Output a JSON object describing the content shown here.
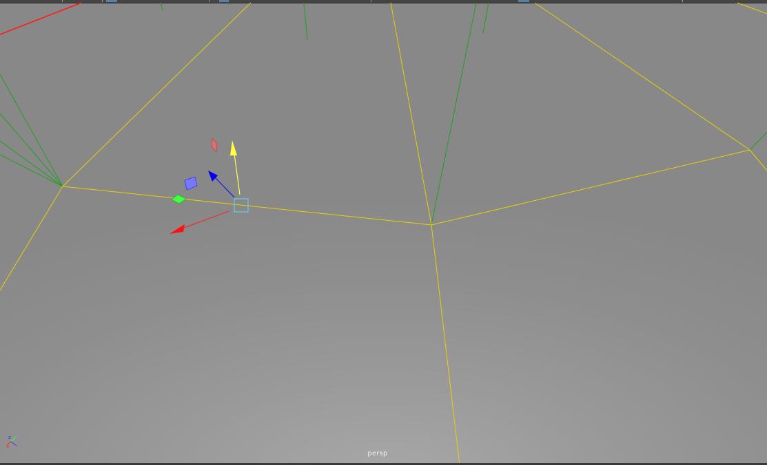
{
  "viewport": {
    "camera_name": "persp",
    "panel": "perspective-view"
  },
  "axis_indicator": {
    "labels": [
      "z",
      "x"
    ]
  },
  "manipulator": {
    "type": "move-tool",
    "colors": {
      "x_axis": "#ff0000",
      "y_axis": "#ffff44",
      "z_axis": "#0000ff",
      "plane_xy": "#7070ff",
      "plane_yz": "#e06060",
      "plane_xz": "#33ff33",
      "center_handle": "#66ccee"
    }
  },
  "colors": {
    "wireframe_selected": "#e6d200",
    "wireframe_normals": "#1fa11f",
    "grid_axis": "#ff0000",
    "background": "#959595"
  }
}
